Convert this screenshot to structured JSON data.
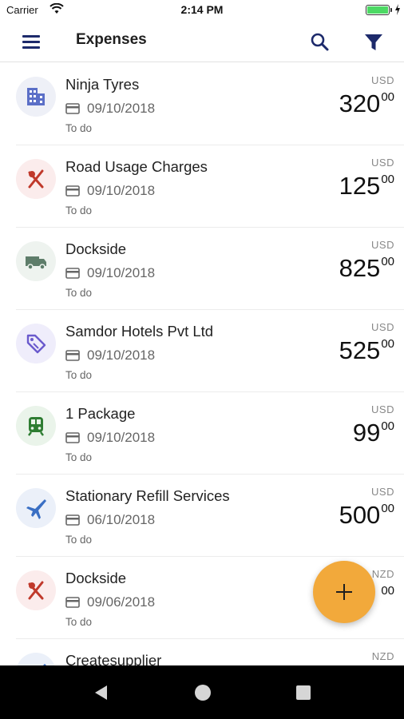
{
  "status_bar": {
    "carrier": "Carrier",
    "time": "2:14 PM",
    "battery": 1.0
  },
  "app_bar": {
    "title": "Expenses",
    "icons": [
      "menu-icon",
      "search-icon",
      "filter-icon"
    ]
  },
  "expenses": [
    {
      "name": "Ninja Tyres",
      "date": "09/10/2018",
      "status": "To do",
      "currency": "USD",
      "amount_int": "320",
      "amount_dec": "00",
      "category_icon": "building-icon",
      "category_color": "#5b6fc7",
      "category_bg": "#eef0f7"
    },
    {
      "name": "Road Usage Charges",
      "date": "09/10/2018",
      "status": "To do",
      "currency": "USD",
      "amount_int": "125",
      "amount_dec": "00",
      "category_icon": "restaurant-icon",
      "category_color": "#c0392b",
      "category_bg": "#fbecec"
    },
    {
      "name": "Dockside",
      "date": "09/10/2018",
      "status": "To do",
      "currency": "USD",
      "amount_int": "825",
      "amount_dec": "00",
      "category_icon": "truck-icon",
      "category_color": "#5e7d6a",
      "category_bg": "#eef3ef"
    },
    {
      "name": "Samdor Hotels Pvt Ltd",
      "date": "09/10/2018",
      "status": "To do",
      "currency": "USD",
      "amount_int": "525",
      "amount_dec": "00",
      "category_icon": "tag-icon",
      "category_color": "#6a5acd",
      "category_bg": "#efedfb"
    },
    {
      "name": "1 Package",
      "date": "09/10/2018",
      "status": "To do",
      "currency": "USD",
      "amount_int": "99",
      "amount_dec": "00",
      "category_icon": "train-icon",
      "category_color": "#2e7d32",
      "category_bg": "#eaf4ea"
    },
    {
      "name": "Stationary Refill Services",
      "date": "06/10/2018",
      "status": "To do",
      "currency": "USD",
      "amount_int": "500",
      "amount_dec": "00",
      "category_icon": "airplane-icon",
      "category_color": "#3a6fc4",
      "category_bg": "#ebf0f9"
    },
    {
      "name": "Dockside",
      "date": "09/06/2018",
      "status": "To do",
      "currency": "NZD",
      "amount_int": "",
      "amount_dec": "00",
      "category_icon": "restaurant-icon",
      "category_color": "#c0392b",
      "category_bg": "#fbecec"
    },
    {
      "name": "Createsupplier",
      "date": "",
      "status": "",
      "currency": "NZD",
      "amount_int": "",
      "amount_dec": "",
      "category_icon": "airplane-icon",
      "category_color": "#3a6fc4",
      "category_bg": "#ebf0f9"
    }
  ],
  "fab": {
    "label": "+",
    "color": "#f2a93b",
    "icon": "plus-icon"
  },
  "nav_bar": {
    "icons": [
      "back-icon",
      "home-icon",
      "recent-apps-icon"
    ]
  }
}
